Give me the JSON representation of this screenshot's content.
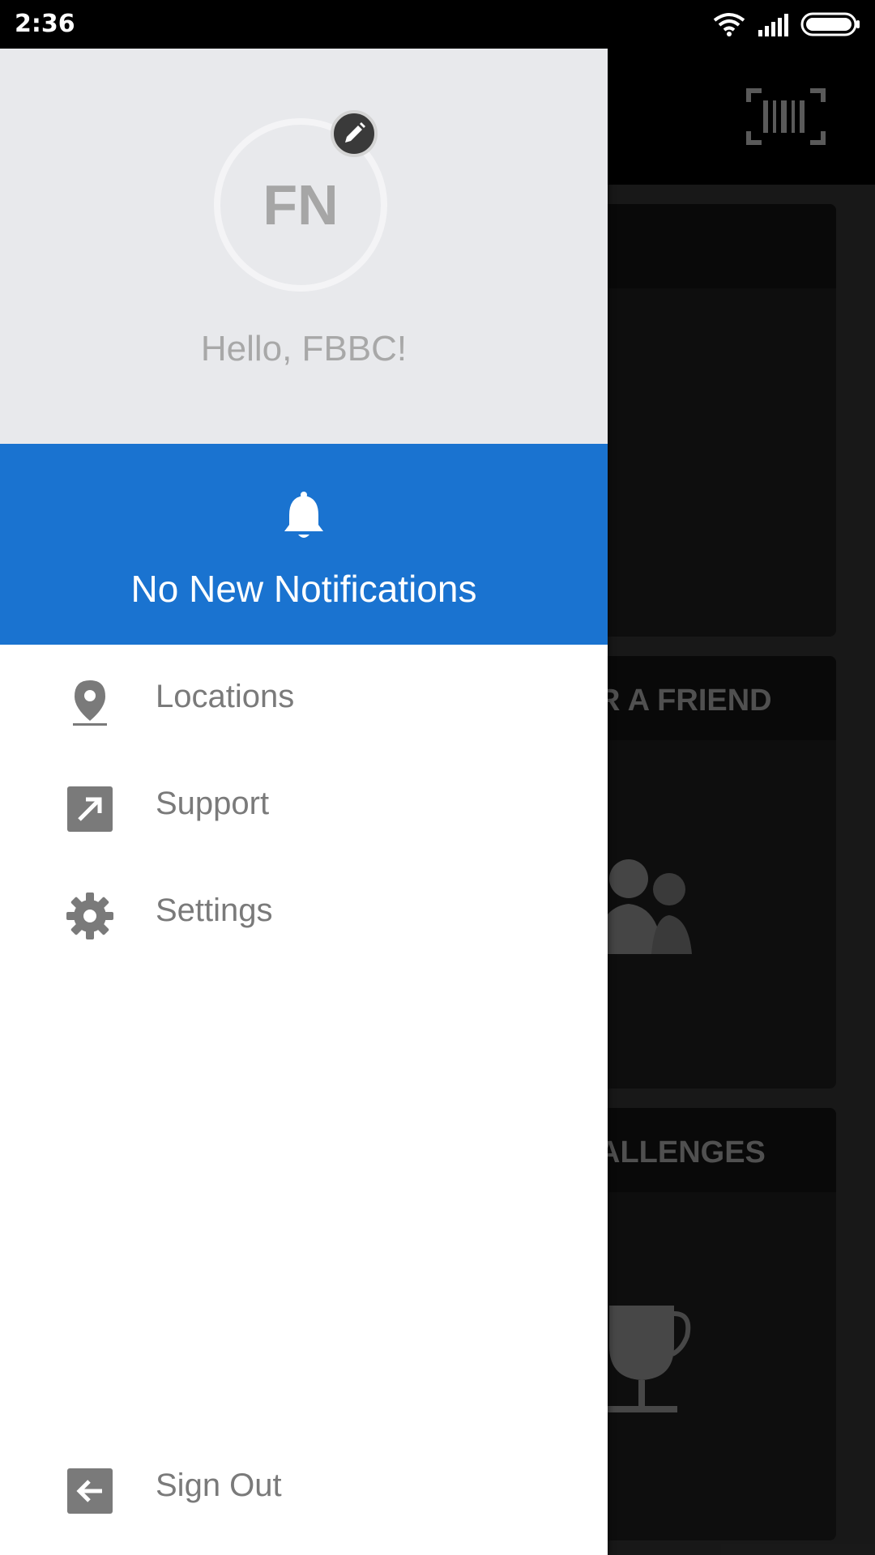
{
  "status_bar": {
    "time": "2:36"
  },
  "drawer": {
    "avatar_initials": "FN",
    "greeting": "Hello, FBBC!",
    "notification_text": "No New Notifications",
    "menu": [
      {
        "label": "Locations",
        "icon": "location-pin-icon"
      },
      {
        "label": "Support",
        "icon": "external-link-icon"
      },
      {
        "label": "Settings",
        "icon": "gear-icon"
      }
    ],
    "sign_out": {
      "label": "Sign Out",
      "icon": "sign-out-icon"
    }
  },
  "background_cards": [
    {
      "title": ""
    },
    {
      "title": "R A FRIEND"
    },
    {
      "title": "ALLENGES"
    }
  ],
  "colors": {
    "accent": "#1a73d0",
    "header_bg": "#e8e9ec",
    "text_muted": "#7a7a7a"
  }
}
